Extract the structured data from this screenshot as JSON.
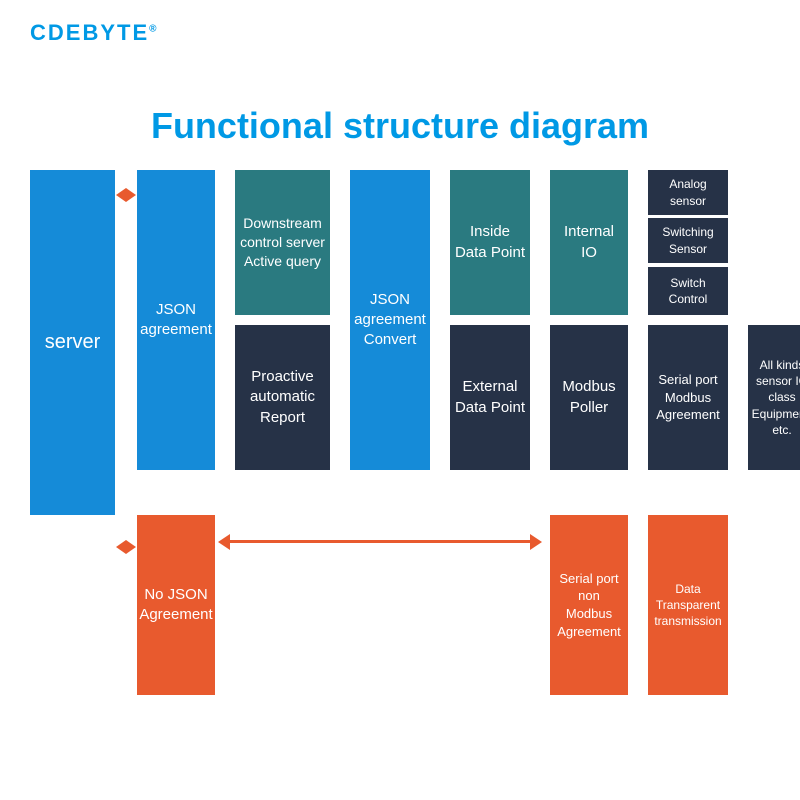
{
  "logo": "CDEBYTE",
  "title": "Functional structure diagram",
  "boxes": {
    "server": "server",
    "json_agreement": "JSON agreement",
    "downstream": "Downstream control server Active query",
    "proactive": "Proactive automatic Report",
    "no_json": "No JSON Agreement",
    "json_convert": "JSON agreement Convert",
    "inside_dp": "Inside Data Point",
    "external_dp": "External Data Point",
    "internal_io": "Internal IO",
    "modbus_poller": "Modbus Poller",
    "analog": "Analog sensor",
    "switching": "Switching Sensor",
    "switch_control": "Switch Control",
    "serial_modbus": "Serial port Modbus Agreement",
    "all_kinds": "All kinds sensor IO class Equipment, etc.",
    "serial_non_modbus": "Serial port non Modbus Agreement",
    "data_transparent": "Data Transparent transmission"
  }
}
